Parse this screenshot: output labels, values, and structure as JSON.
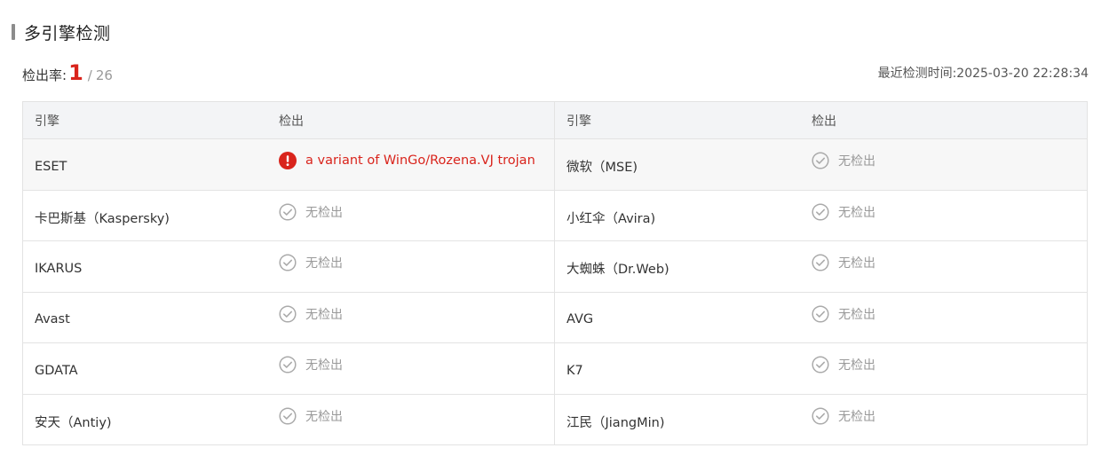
{
  "section": {
    "title": "多引擎检测"
  },
  "summary": {
    "rate_label": "检出率:",
    "detected": "1",
    "separator": "/",
    "total": "26",
    "last_scan_label": "最近检测时间:",
    "last_scan_time": "2025-03-20 22:28:34"
  },
  "table": {
    "headers": {
      "engine": "引擎",
      "result": "检出"
    },
    "rows": [
      {
        "left": {
          "engine": "ESET",
          "result": "a variant of WinGo/Rozena.VJ trojan",
          "status": "detected"
        },
        "right": {
          "engine": "微软（MSE)",
          "result": "无检出",
          "status": "clean"
        }
      },
      {
        "left": {
          "engine": "卡巴斯基（Kaspersky)",
          "result": "无检出",
          "status": "clean"
        },
        "right": {
          "engine": "小红伞（Avira)",
          "result": "无检出",
          "status": "clean"
        }
      },
      {
        "left": {
          "engine": "IKARUS",
          "result": "无检出",
          "status": "clean"
        },
        "right": {
          "engine": "大蜘蛛（Dr.Web)",
          "result": "无检出",
          "status": "clean"
        }
      },
      {
        "left": {
          "engine": "Avast",
          "result": "无检出",
          "status": "clean"
        },
        "right": {
          "engine": "AVG",
          "result": "无检出",
          "status": "clean"
        }
      },
      {
        "left": {
          "engine": "GDATA",
          "result": "无检出",
          "status": "clean"
        },
        "right": {
          "engine": "K7",
          "result": "无检出",
          "status": "clean"
        }
      },
      {
        "left": {
          "engine": "安天（Antiy)",
          "result": "无检出",
          "status": "clean"
        },
        "right": {
          "engine": "江民（JiangMin)",
          "result": "无检出",
          "status": "clean"
        }
      }
    ]
  },
  "icons": {
    "detected": "alert-circle-icon",
    "clean": "check-circle-icon"
  },
  "colors": {
    "detected": "#d9241c",
    "clean": "#999999",
    "header_bg": "#f3f4f6",
    "highlight_bg": "#f7f7f7",
    "border": "#e3e3e3"
  }
}
